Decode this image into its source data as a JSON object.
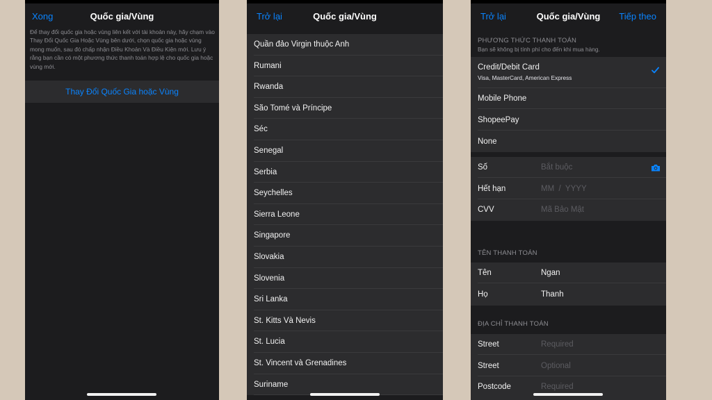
{
  "screen1": {
    "nav_left": "Xong",
    "title": "Quốc gia/Vùng",
    "description": "Để thay đổi quốc gia hoặc vùng liên kết với tài khoản này, hãy chạm vào Thay Đổi Quốc Gia Hoặc Vùng bên dưới, chọn quốc gia hoặc vùng mong muốn, sau đó chấp nhận Điều Khoản Và Điều Kiện mới. Lưu ý rằng bạn cần có một phương thức thanh toán hợp lệ cho quốc gia hoặc vùng mới.",
    "change_button": "Thay Đổi Quốc Gia hoặc Vùng"
  },
  "screen2": {
    "nav_left": "Trở lại",
    "title": "Quốc gia/Vùng",
    "countries": [
      "Quần đảo Virgin thuộc Anh",
      "Rumani",
      "Rwanda",
      "São Tomé và Príncipe",
      "Séc",
      "Senegal",
      "Serbia",
      "Seychelles",
      "Sierra Leone",
      "Singapore",
      "Slovakia",
      "Slovenia",
      "Sri Lanka",
      "St. Kitts Và Nevis",
      "St. Lucia",
      "St. Vincent và Grenadines",
      "Suriname"
    ]
  },
  "screen3": {
    "nav_left": "Trở lại",
    "title": "Quốc gia/Vùng",
    "nav_right": "Tiếp theo",
    "payment_header": "PHƯƠNG THỨC THANH TOÁN",
    "payment_note": "Bạn sẽ không bị tính phí cho đến khi mua hàng.",
    "payment_methods": {
      "card": "Credit/Debit Card",
      "card_sub": "Visa, MasterCard, American Express",
      "mobile": "Mobile Phone",
      "shopee": "ShopeePay",
      "none": "None"
    },
    "card_fields": {
      "number_label": "Số",
      "number_placeholder": "Bắt buộc",
      "expiry_label": "Hết hạn",
      "expiry_placeholder": "MM  /  YYYY",
      "cvv_label": "CVV",
      "cvv_placeholder": "Mã Bảo Mật"
    },
    "name_header": "TÊN THANH TOÁN",
    "name_fields": {
      "first_label": "Tên",
      "first_value": "Ngan",
      "last_label": "Họ",
      "last_value": "Thanh"
    },
    "address_header": "ĐỊA CHỈ THANH TOÁN",
    "address_fields": {
      "street1_label": "Street",
      "street1_placeholder": "Required",
      "street2_label": "Street",
      "street2_placeholder": "Optional",
      "postcode_label": "Postcode",
      "postcode_placeholder": "Required"
    }
  },
  "colors": {
    "accent": "#0a84ff",
    "background": "#d5c8b8",
    "screen": "#1c1c1e",
    "cell": "#2c2c2e"
  },
  "icons": {
    "selected": "checkmark-icon",
    "scan_card": "camera-icon"
  }
}
